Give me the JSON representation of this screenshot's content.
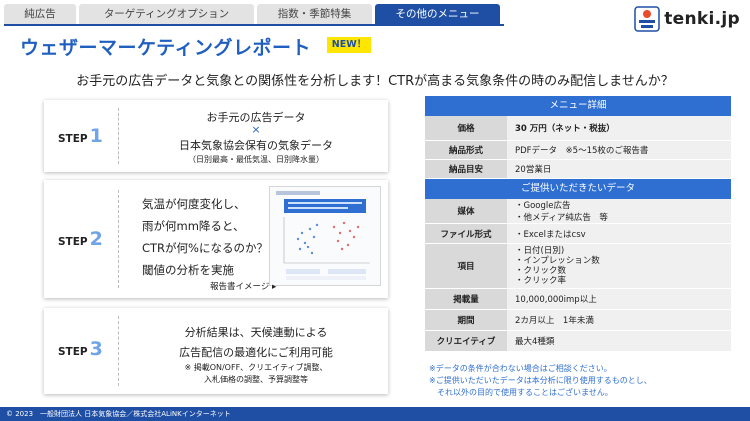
{
  "tabs": [
    {
      "label": "純広告",
      "active": false
    },
    {
      "label": "ターゲティングオプション",
      "active": false
    },
    {
      "label": "指数・季節特集",
      "active": false
    },
    {
      "label": "その他のメニュー",
      "active": true
    }
  ],
  "logo": {
    "text": "tenki.jp"
  },
  "title": "ウェザーマーケティングレポート",
  "badge": "NEW！",
  "lead": "お手元の広告データと気象との関係性を分析します！CTRが高まる気象条件の時のみ配信しませんか？",
  "steps": {
    "s1": {
      "label": "STEP",
      "num": "1",
      "line1": "お手元の広告データ",
      "cross": "×",
      "line2": "日本気象協会保有の気象データ",
      "line3": "（日別最高・最低気温、日別降水量）"
    },
    "s2": {
      "label": "STEP",
      "num": "2",
      "lines": [
        "気温が何度変化し、",
        "雨が何mm降ると、",
        "CTRが何%になるのか？",
        "閾値の分析を実施"
      ],
      "caption": "報告書イメージ ▸"
    },
    "s3": {
      "label": "STEP",
      "num": "3",
      "line1": "分析結果は、天候連動による",
      "line2": "広告配信の最適化にご利用可能",
      "note1": "※ 掲載ON/OFF、クリエイティブ調整、",
      "note2": "入札価格の調整、予算調整等"
    }
  },
  "menu": {
    "header1": "メニュー詳細",
    "rows1": [
      {
        "key": "価格",
        "value": "30 万円（ネット・税抜）"
      },
      {
        "key": "納品形式",
        "value": "PDFデータ　※5～15枚のご報告書"
      },
      {
        "key": "納品目安",
        "value": "20営業日"
      }
    ],
    "header2": "ご提供いただきたいデータ",
    "rows2": [
      {
        "key": "媒体",
        "values": [
          "・Google広告",
          "・他メディア純広告　等"
        ]
      },
      {
        "key": "ファイル形式",
        "values": [
          "・Excelまたはcsv"
        ]
      },
      {
        "key": "項目",
        "values": [
          "・日付(日別)",
          "・インプレッション数",
          "・クリック数",
          "・クリック率"
        ]
      },
      {
        "key": "掲載量",
        "values": [
          "10,000,000imp以上"
        ]
      },
      {
        "key": "期間",
        "values": [
          "2カ月以上　1年未満"
        ]
      },
      {
        "key": "クリエイティブ",
        "values": [
          "最大4種類"
        ]
      }
    ]
  },
  "notes": [
    "※データの条件が合わない場合はご相談ください。",
    "※ご提供いただいたデータは本分析に限り使用するものとし、",
    "　それ以外の目的で使用することはございません。"
  ],
  "footer": "© 2023　一般財団法人 日本気象協会／株式会社ALiNKインターネット",
  "colors": {
    "primary": "#1f4fa5",
    "accent": "#2f6fd2",
    "badge": "#ffe600",
    "title": "#1f5fbf"
  }
}
